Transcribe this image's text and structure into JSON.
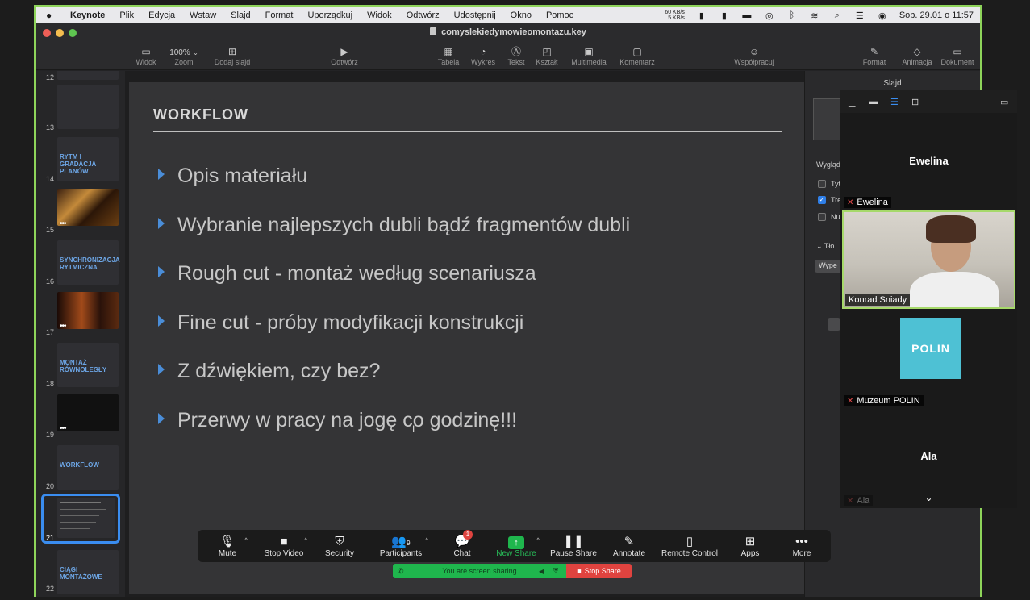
{
  "menubar": {
    "apple": "",
    "app": "Keynote",
    "items": [
      "Plik",
      "Edycja",
      "Wstaw",
      "Slajd",
      "Format",
      "Uporządkuj",
      "Widok",
      "Odtwórz",
      "Udostępnij",
      "Okno",
      "Pomoc"
    ],
    "net_up": "60 KB/s",
    "net_down": "5 KB/s",
    "clock": "Sob. 29.01 o 11:57"
  },
  "toolbar": {
    "doc_title": "comyslekiedymowieomontazu.key",
    "view": "Widok",
    "zoom_value": "100%",
    "zoom": "Zoom",
    "add_slide": "Dodaj slajd",
    "play": "Odtwórz",
    "table": "Tabela",
    "chart": "Wykres",
    "text": "Tekst",
    "shape": "Kształt",
    "media": "Multimedia",
    "comment": "Komentarz",
    "collaborate": "Współpracuj",
    "format": "Format",
    "animate": "Animacja",
    "document": "Dokument"
  },
  "navigator": {
    "items": [
      {
        "num": "12",
        "title": ""
      },
      {
        "num": "13",
        "title": ""
      },
      {
        "num": "14",
        "title": "RYTM I GRADACJA PLANÓW"
      },
      {
        "num": "15",
        "title": ""
      },
      {
        "num": "16",
        "title": "SYNCHRONIZACJA RYTMICZNA"
      },
      {
        "num": "17",
        "title": ""
      },
      {
        "num": "18",
        "title": "MONTAŻ RÓWNOLEGŁY"
      },
      {
        "num": "19",
        "title": ""
      },
      {
        "num": "20",
        "title": "WORKFLOW"
      },
      {
        "num": "21",
        "title": ""
      },
      {
        "num": "22",
        "title": "CIĄGI MONTAŻOWE"
      }
    ]
  },
  "slide": {
    "title": "WORKFLOW",
    "bullets": [
      "Opis materiału",
      "Wybranie najlepszych dubli bądź fragmentów dubli",
      "Rough cut - montaż według scenariusza",
      "Fine cut - próby modyfikacji konstrukcji",
      "Z dźwiękiem, czy bez?",
      "Przerwy w pracy na jogę co godzinę!!!"
    ]
  },
  "inspector": {
    "title": "Slajd",
    "appearance": "Wygląd",
    "opt1": "Tyt",
    "opt2": "Tre",
    "opt3": "Nu",
    "background": "Tło",
    "fill": "Wype"
  },
  "participants": {
    "ewelina_name": "Ewelina",
    "ewelina_tag": "Ewelina",
    "konrad_tag": "Konrad Sniady",
    "polin_logo": "POLIN",
    "polin_tag": "Muzeum POLIN",
    "ala_name": "Ala",
    "ala_tag": "Ala"
  },
  "zoom_controls": {
    "mute": "Mute",
    "stop_video": "Stop Video",
    "security": "Security",
    "participants": "Participants",
    "participants_count": "9",
    "chat": "Chat",
    "chat_badge": "1",
    "new_share": "New Share",
    "pause_share": "Pause Share",
    "annotate": "Annotate",
    "remote_control": "Remote Control",
    "apps": "Apps",
    "more": "More",
    "sharing_status": "You are screen sharing",
    "stop_share": "Stop Share"
  },
  "colors": {
    "frame_border": "#8ed45a",
    "accent_blue": "#3a8df0",
    "share_green": "#1fb64d",
    "stop_red": "#e0433f"
  }
}
